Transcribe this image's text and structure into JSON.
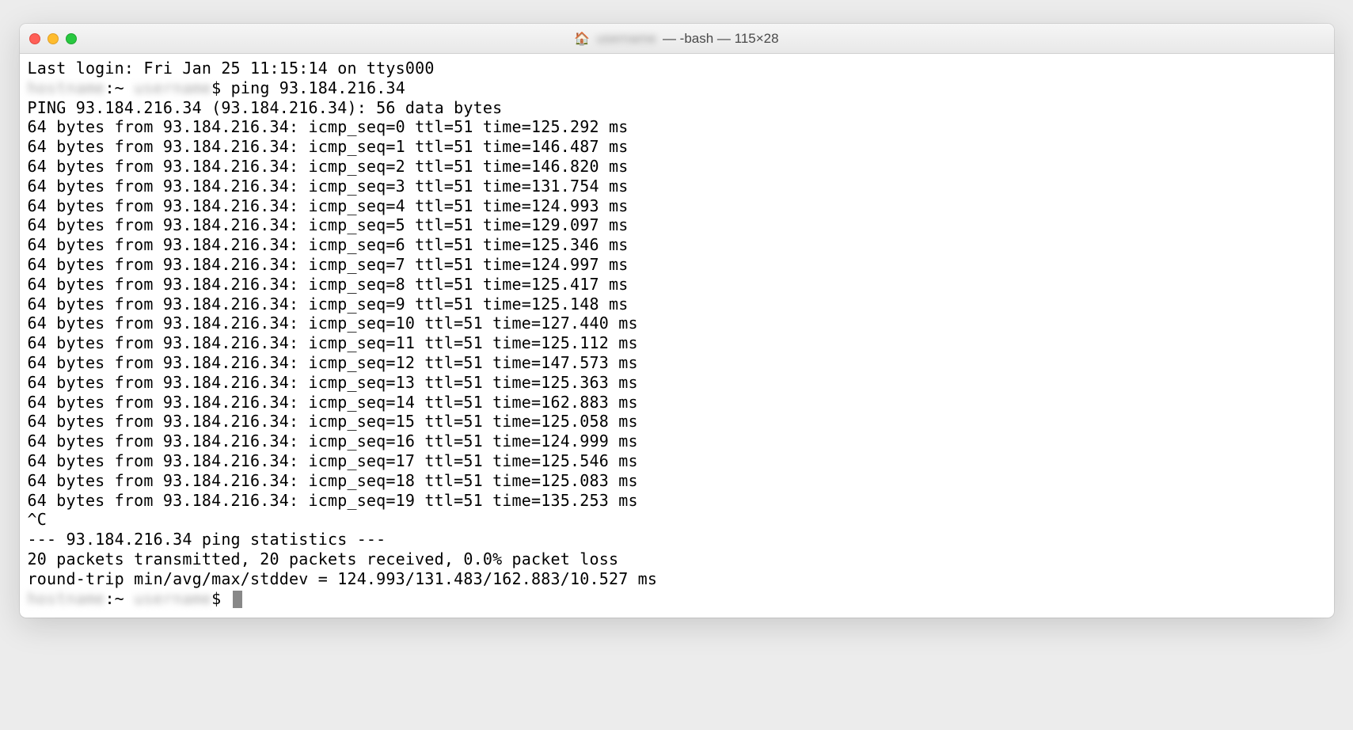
{
  "titlebar": {
    "home_icon": "🏠",
    "user_redacted": "username",
    "shell_suffix": " — -bash — 115×28"
  },
  "terminal": {
    "last_login": "Last login: Fri Jan 25 11:15:14 on ttys000",
    "prompt_prefix_redacted": "hostname",
    "prompt_mid": ":~ ",
    "prompt_user_redacted": "username",
    "prompt_suffix": "$ ",
    "command": "ping 93.184.216.34",
    "ping_header": "PING 93.184.216.34 (93.184.216.34): 56 data bytes",
    "replies": [
      "64 bytes from 93.184.216.34: icmp_seq=0 ttl=51 time=125.292 ms",
      "64 bytes from 93.184.216.34: icmp_seq=1 ttl=51 time=146.487 ms",
      "64 bytes from 93.184.216.34: icmp_seq=2 ttl=51 time=146.820 ms",
      "64 bytes from 93.184.216.34: icmp_seq=3 ttl=51 time=131.754 ms",
      "64 bytes from 93.184.216.34: icmp_seq=4 ttl=51 time=124.993 ms",
      "64 bytes from 93.184.216.34: icmp_seq=5 ttl=51 time=129.097 ms",
      "64 bytes from 93.184.216.34: icmp_seq=6 ttl=51 time=125.346 ms",
      "64 bytes from 93.184.216.34: icmp_seq=7 ttl=51 time=124.997 ms",
      "64 bytes from 93.184.216.34: icmp_seq=8 ttl=51 time=125.417 ms",
      "64 bytes from 93.184.216.34: icmp_seq=9 ttl=51 time=125.148 ms",
      "64 bytes from 93.184.216.34: icmp_seq=10 ttl=51 time=127.440 ms",
      "64 bytes from 93.184.216.34: icmp_seq=11 ttl=51 time=125.112 ms",
      "64 bytes from 93.184.216.34: icmp_seq=12 ttl=51 time=147.573 ms",
      "64 bytes from 93.184.216.34: icmp_seq=13 ttl=51 time=125.363 ms",
      "64 bytes from 93.184.216.34: icmp_seq=14 ttl=51 time=162.883 ms",
      "64 bytes from 93.184.216.34: icmp_seq=15 ttl=51 time=125.058 ms",
      "64 bytes from 93.184.216.34: icmp_seq=16 ttl=51 time=124.999 ms",
      "64 bytes from 93.184.216.34: icmp_seq=17 ttl=51 time=125.546 ms",
      "64 bytes from 93.184.216.34: icmp_seq=18 ttl=51 time=125.083 ms",
      "64 bytes from 93.184.216.34: icmp_seq=19 ttl=51 time=135.253 ms"
    ],
    "ctrl_c": "^C",
    "stats_header": "--- 93.184.216.34 ping statistics ---",
    "stats_packets": "20 packets transmitted, 20 packets received, 0.0% packet loss",
    "stats_rtt": "round-trip min/avg/max/stddev = 124.993/131.483/162.883/10.527 ms"
  }
}
